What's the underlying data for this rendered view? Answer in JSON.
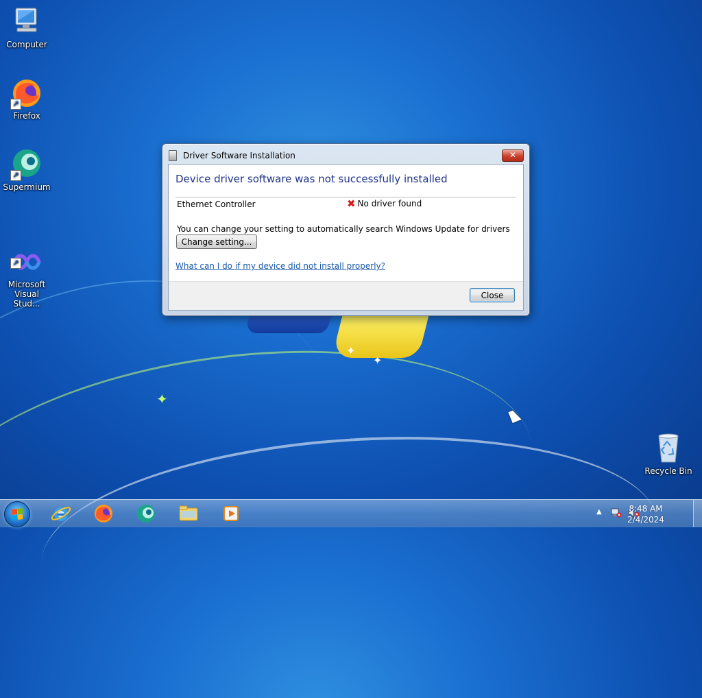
{
  "desktop": {
    "icons": [
      {
        "label": "Computer",
        "icon": "computer-icon"
      },
      {
        "label": "Firefox",
        "icon": "firefox-icon"
      },
      {
        "label": "Supermium",
        "icon": "supermium-icon"
      },
      {
        "label": "Microsoft\nVisual Stud...",
        "icon": "visual-studio-icon"
      },
      {
        "label": "Recycle Bin",
        "icon": "recycle-bin-icon"
      }
    ]
  },
  "dialog": {
    "title": "Driver Software Installation",
    "close_symbol": "✕",
    "heading": "Device driver software was not successfully installed",
    "device_name": "Ethernet Controller",
    "device_status": "No driver found",
    "info_text": "You can change your setting to automatically search Windows Update for drivers",
    "change_setting_label": "Change setting...",
    "help_link": "What can I do if my device did not install properly?",
    "close_label": "Close"
  },
  "taskbar": {
    "pinned": [
      "internet-explorer-icon",
      "firefox-icon",
      "supermium-icon",
      "windows-explorer-icon",
      "media-player-icon"
    ],
    "tray_arrow": "▲",
    "clock_time": "8:48 AM",
    "clock_date": "2/4/2024"
  },
  "colors": {
    "heading": "#1e3287",
    "link": "#1a5aa8",
    "error": "#d21f1f"
  }
}
